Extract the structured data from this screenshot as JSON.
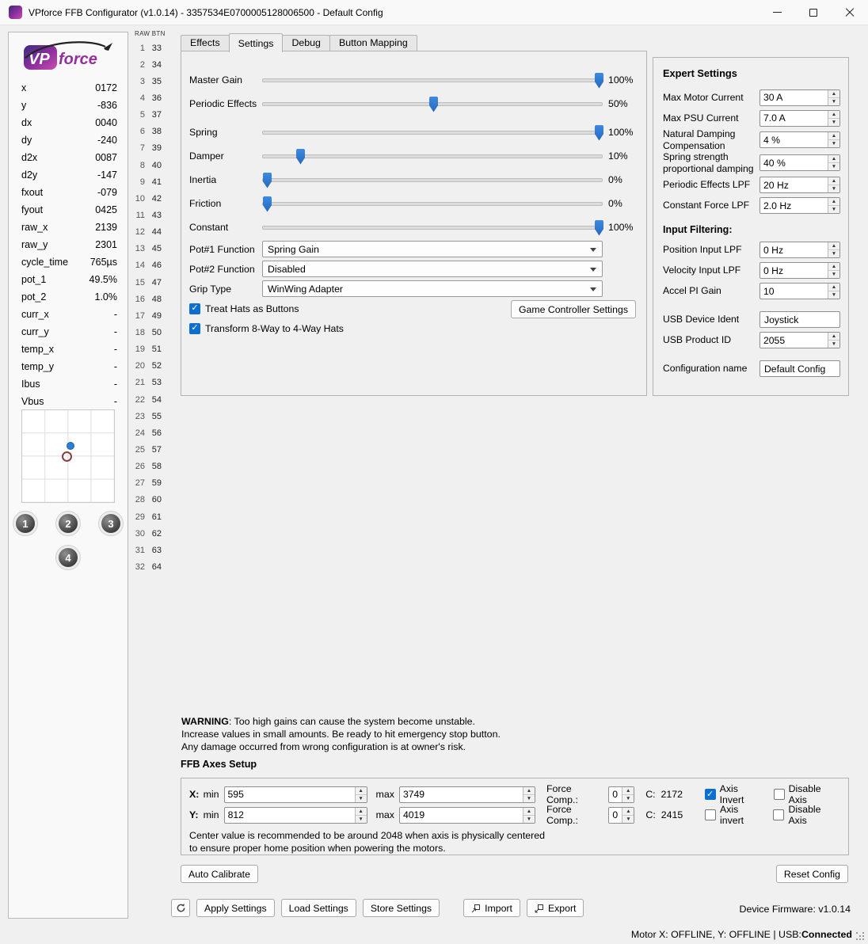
{
  "window": {
    "title": "VPforce FFB Configurator (v1.0.14) - 3357534E0700005128006500 - Default Config"
  },
  "sidebar": {
    "logo_vp": "VP",
    "logo_force": "force",
    "telemetry": [
      [
        "x",
        "0172"
      ],
      [
        "y",
        "-836"
      ],
      [
        "dx",
        "0040"
      ],
      [
        "dy",
        "-240"
      ],
      [
        "d2x",
        "0087"
      ],
      [
        "d2y",
        "-147"
      ],
      [
        "fxout",
        "-079"
      ],
      [
        "fyout",
        "0425"
      ],
      [
        "raw_x",
        "2139"
      ],
      [
        "raw_y",
        "2301"
      ],
      [
        "cycle_time",
        "765µs"
      ],
      [
        "pot_1",
        "49.5%"
      ],
      [
        "pot_2",
        "1.0%"
      ],
      [
        "curr_x",
        "-"
      ],
      [
        "curr_y",
        "-"
      ],
      [
        "temp_x",
        "-"
      ],
      [
        "temp_y",
        "-"
      ],
      [
        "Ibus",
        "-"
      ],
      [
        "Vbus",
        "-"
      ]
    ],
    "profile_buttons": [
      "1",
      "2",
      "3",
      "4"
    ]
  },
  "raw_btn": {
    "header": "RAW BTN",
    "pairs": [
      [
        1,
        33
      ],
      [
        2,
        34
      ],
      [
        3,
        35
      ],
      [
        4,
        36
      ],
      [
        5,
        37
      ],
      [
        6,
        38
      ],
      [
        7,
        39
      ],
      [
        8,
        40
      ],
      [
        9,
        41
      ],
      [
        10,
        42
      ],
      [
        11,
        43
      ],
      [
        12,
        44
      ],
      [
        13,
        45
      ],
      [
        14,
        46
      ],
      [
        15,
        47
      ],
      [
        16,
        48
      ],
      [
        17,
        49
      ],
      [
        18,
        50
      ],
      [
        19,
        51
      ],
      [
        20,
        52
      ],
      [
        21,
        53
      ],
      [
        22,
        54
      ],
      [
        23,
        55
      ],
      [
        24,
        56
      ],
      [
        25,
        57
      ],
      [
        26,
        58
      ],
      [
        27,
        59
      ],
      [
        28,
        60
      ],
      [
        29,
        61
      ],
      [
        30,
        62
      ],
      [
        31,
        63
      ],
      [
        32,
        64
      ]
    ]
  },
  "tabs": [
    {
      "label": "Effects",
      "active": false
    },
    {
      "label": "Settings",
      "active": true
    },
    {
      "label": "Debug",
      "active": false
    },
    {
      "label": "Button Mapping",
      "active": false
    }
  ],
  "settings": {
    "sliders": [
      {
        "label": "Master Gain",
        "percent": 100,
        "display": "100%"
      },
      {
        "label": "Periodic Effects",
        "percent": 50,
        "display": "50%"
      },
      {
        "label": "Spring",
        "percent": 100,
        "display": "100%"
      },
      {
        "label": "Damper",
        "percent": 10,
        "display": "10%"
      },
      {
        "label": "Inertia",
        "percent": 0,
        "display": "0%"
      },
      {
        "label": "Friction",
        "percent": 0,
        "display": "0%"
      },
      {
        "label": "Constant",
        "percent": 100,
        "display": "100%"
      }
    ],
    "dropdowns": [
      {
        "label": "Pot#1 Function",
        "value": "Spring Gain"
      },
      {
        "label": "Pot#2 Function",
        "value": "Disabled"
      },
      {
        "label": "Grip Type",
        "value": "WinWing Adapter"
      }
    ],
    "checkboxes": [
      {
        "label": "Treat Hats as Buttons",
        "checked": true
      },
      {
        "label": "Transform 8-Way to 4-Way Hats",
        "checked": true
      }
    ],
    "game_controller_button": "Game Controller Settings"
  },
  "expert": {
    "title": "Expert Settings",
    "groups": [
      {
        "rows": [
          {
            "label": "Max Motor Current",
            "value": "30 A",
            "type": "spin"
          },
          {
            "label": "Max PSU Current",
            "value": "7.0 A",
            "type": "spin"
          },
          {
            "label": "Natural Damping Compensation",
            "value": "4 %",
            "type": "spin"
          },
          {
            "label": "Spring strength proportional damping",
            "value": "40 %",
            "type": "spin"
          },
          {
            "label": "Periodic Effects LPF",
            "value": "20 Hz",
            "type": "spin"
          },
          {
            "label": "Constant Force LPF",
            "value": "2.0 Hz",
            "type": "spin"
          }
        ]
      },
      {
        "header": "Input Filtering:",
        "rows": [
          {
            "label": "Position Input LPF",
            "value": "0 Hz",
            "type": "spin"
          },
          {
            "label": "Velocity Input LPF",
            "value": "0 Hz",
            "type": "spin"
          },
          {
            "label": "Accel PI Gain",
            "value": "10",
            "type": "spin"
          }
        ]
      },
      {
        "rows": [
          {
            "label": "USB Device Ident",
            "value": "Joystick",
            "type": "text"
          },
          {
            "label": "USB Product ID",
            "value": "2055",
            "type": "spin"
          }
        ]
      },
      {
        "rows": [
          {
            "label": "Configuration name",
            "value": "Default Config",
            "type": "text"
          }
        ]
      }
    ]
  },
  "warning": {
    "label": "WARNING",
    "rest": ": Too high gains can cause the system become unstable.",
    "line2": "Increase values in small amounts. Be ready to hit emergency stop button.",
    "line3": "Any damage occurred from wrong configuration is at owner's risk."
  },
  "ffb": {
    "title": "FFB Axes Setup",
    "axes": [
      {
        "axis": "X:",
        "min_label": "min",
        "min": "595",
        "max_label": "max",
        "max": "3749",
        "force_label": "Force Comp.:",
        "force": "0",
        "center_label": "C:",
        "center": "2172",
        "invert_label": "Axis Invert",
        "invert": true,
        "disable_label": "Disable Axis",
        "disable": false
      },
      {
        "axis": "Y:",
        "min_label": "min",
        "min": "812",
        "max_label": "max",
        "max": "4019",
        "force_label": "Force Comp.:",
        "force": "0",
        "center_label": "C:",
        "center": "2415",
        "invert_label": "Axis invert",
        "invert": false,
        "disable_label": "Disable Axis",
        "disable": false
      }
    ],
    "note1": "Center value is recommended to be around 2048 when axis is physically centered",
    "note2": "to ensure proper home position when powering the motors.",
    "auto_calibrate": "Auto Calibrate",
    "reset_config": "Reset Config"
  },
  "toolbar": {
    "apply": "Apply Settings",
    "load": "Load Settings",
    "store": "Store Settings",
    "import": "Import",
    "export": "Export",
    "firmware_label": "Device Firmware:",
    "firmware_value": "v1.0.14"
  },
  "status": {
    "left": "Motor X: OFFLINE, Y: OFFLINE | USB: ",
    "usb": "Connected"
  }
}
